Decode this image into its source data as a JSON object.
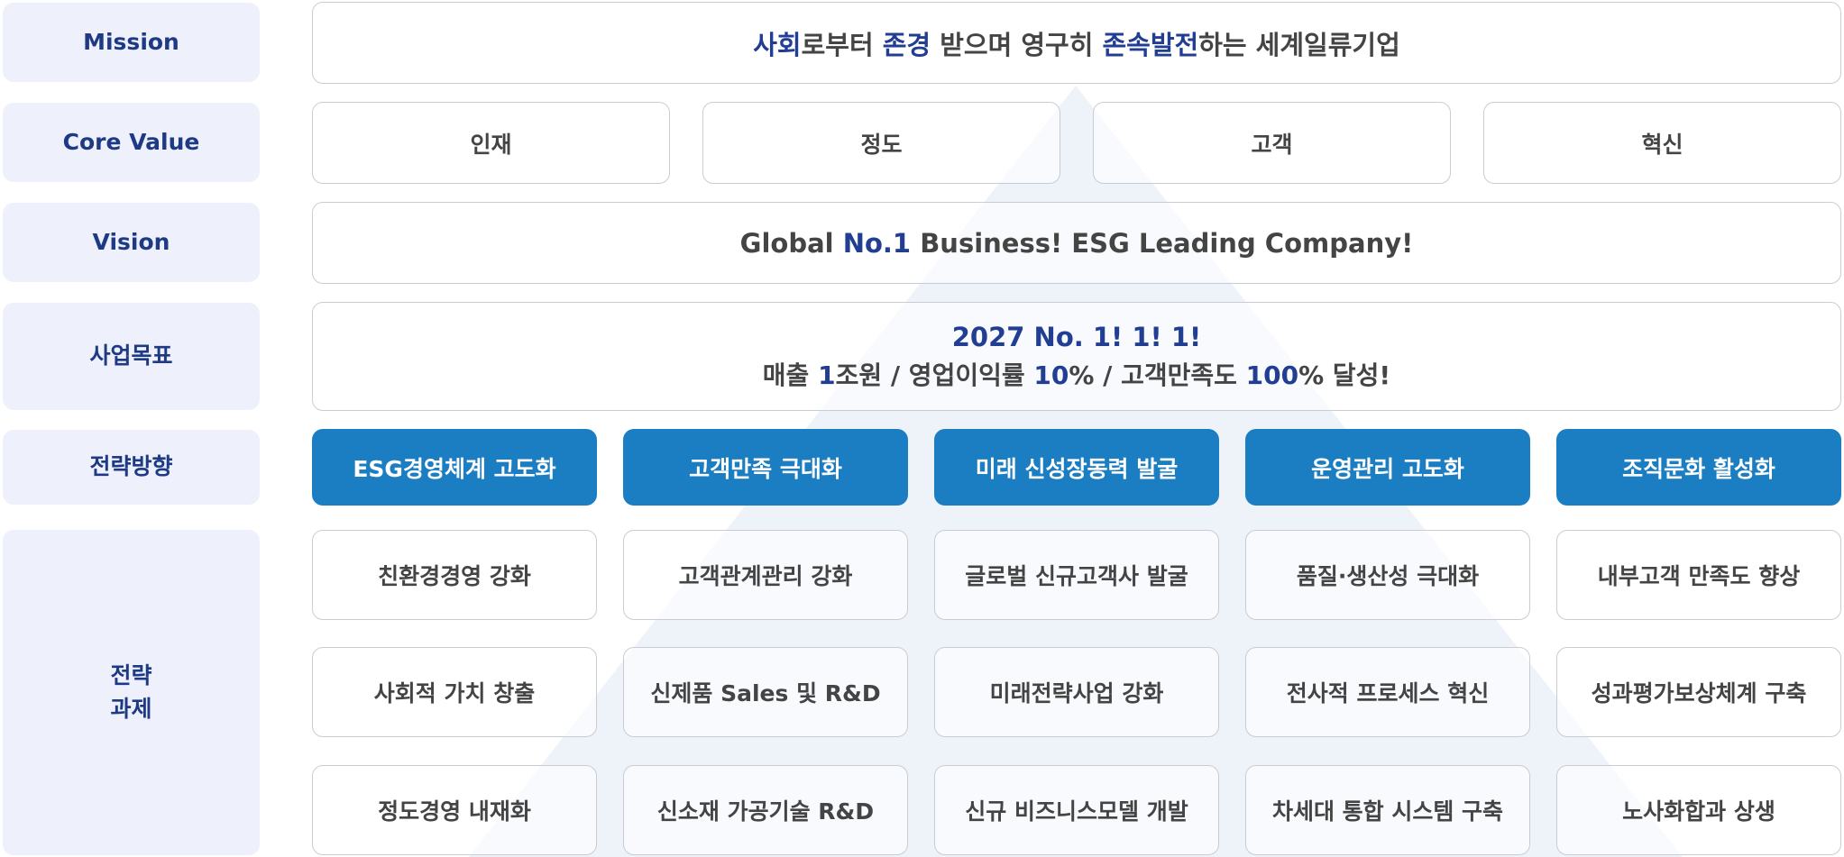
{
  "labels": {
    "mission": "Mission",
    "core_value": "Core Value",
    "vision": "Vision",
    "business_goal": "사업목표",
    "strategy_direction": "전략방향",
    "strategy_task": "전략\n과제"
  },
  "mission": {
    "p1": "사회",
    "p2": "로부터 ",
    "p3": "존경",
    "p4": " 받으며 영구히 ",
    "p5": "존속발전",
    "p6": "하는 세계일류기업"
  },
  "core_values": [
    "인재",
    "정도",
    "고객",
    "혁신"
  ],
  "vision": {
    "p1": "Global ",
    "p2": "No.1",
    "p3": " Business! ESG Leading Company!"
  },
  "business_goal": {
    "line1": "2027 No. 1! 1! 1!",
    "p1": "매출 ",
    "p2": "1",
    "p3": "조원 / 영업이익률 ",
    "p4": "10",
    "p5": "% / 고객만족도 ",
    "p6": "100",
    "p7": "% 달성!"
  },
  "strategy_directions": [
    "ESG경영체계 고도화",
    "고객만족 극대화",
    "미래 신성장동력 발굴",
    "운영관리 고도화",
    "조직문화 활성화"
  ],
  "strategy_tasks": [
    [
      "친환경경영 강화",
      "고객관계관리 강화",
      "글로벌 신규고객사 발굴",
      "품질·생산성 극대화",
      "내부고객 만족도 향상"
    ],
    [
      "사회적 가치 창출",
      "신제품 Sales 및 R&D",
      "미래전략사업 강화",
      "전사적 프로세스 혁신",
      "성과평가보상체계 구축"
    ],
    [
      "정도경영 내재화",
      "신소재 가공기술 R&D",
      "신규 비즈니스모델 개발",
      "차세대 통합 시스템 구축",
      "노사화합과 상생"
    ]
  ],
  "colors": {
    "label_bg": "#eef1fb",
    "label_text": "#1e3a84",
    "highlight": "#213e93",
    "direction_bg": "#1b7ec3",
    "border": "#c9ccd3",
    "text": "#444444"
  }
}
